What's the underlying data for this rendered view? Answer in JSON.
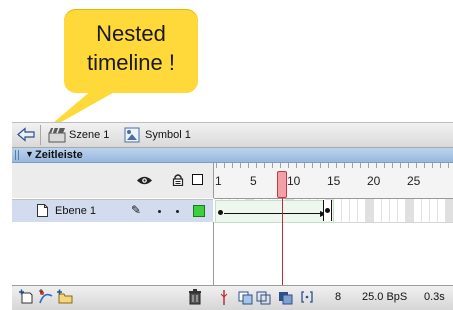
{
  "callout": {
    "line1": "Nested",
    "line2": "timeline !"
  },
  "breadcrumb": {
    "scene_label": "Szene 1",
    "symbol_label": "Symbol 1"
  },
  "panel": {
    "title": "Zeitleiste"
  },
  "ruler": {
    "labels": [
      "1",
      "5",
      "10",
      "15",
      "20",
      "25"
    ]
  },
  "layers": [
    {
      "name": "Ebene 1"
    }
  ],
  "status": {
    "current_frame": "8",
    "frame_rate": "25.0 BpS",
    "elapsed": "0.3s"
  },
  "colors": {
    "callout": "#ffd93a",
    "panel_header": "#a9c4e6",
    "selected_layer": "#d3dbee",
    "playhead": "#c22a35",
    "layer_color_box": "#3dcf3d"
  }
}
